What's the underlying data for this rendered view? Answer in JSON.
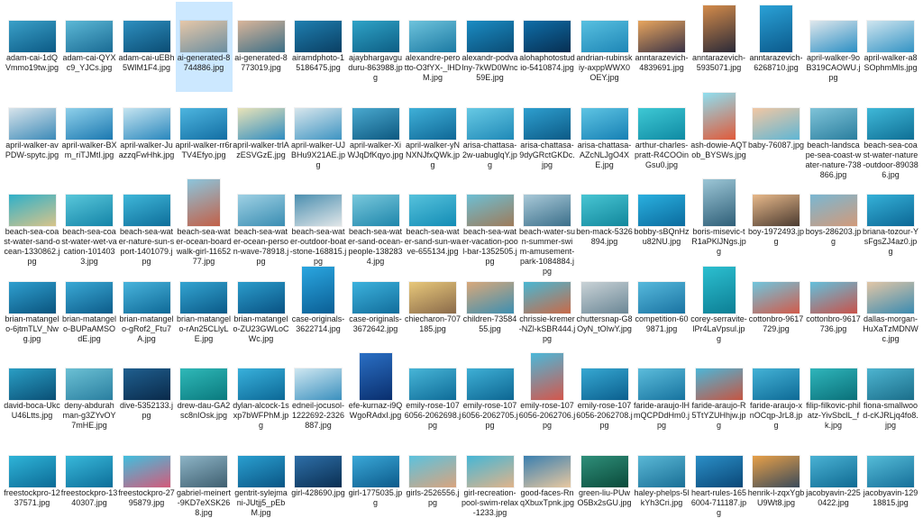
{
  "file_view": {
    "selected_index": 3,
    "files": [
      {
        "name": "adam-cai-1dQVmmo19tw.jpg",
        "orientation": "landscape",
        "colors": [
          "#3aa0c8",
          "#0c5a85"
        ]
      },
      {
        "name": "adam-cai-QYXc9_YJCs.jpg",
        "orientation": "landscape",
        "colors": [
          "#5cb8d6",
          "#1a6b94"
        ]
      },
      {
        "name": "adam-cai-uEBh5WlM1F4.jpg",
        "orientation": "landscape",
        "colors": [
          "#2e8fbf",
          "#0b4d74"
        ]
      },
      {
        "name": "ai-generated-8744886.jpg",
        "orientation": "landscape",
        "colors": [
          "#e6c7a8",
          "#6b8ea0"
        ]
      },
      {
        "name": "ai-generated-8773019.jpg",
        "orientation": "landscape",
        "colors": [
          "#d9b59a",
          "#3b6e86"
        ]
      },
      {
        "name": "airamdphoto-15186475.jpg",
        "orientation": "landscape",
        "colors": [
          "#1f7fb0",
          "#0a3f63"
        ]
      },
      {
        "name": "ajaybhargavguduru-863988.jpg",
        "orientation": "landscape",
        "colors": [
          "#2fa3c7",
          "#0d5e84"
        ]
      },
      {
        "name": "alexandre-perotto-O3fYX-_lHDM.jpg",
        "orientation": "landscape",
        "colors": [
          "#6ec3dc",
          "#1c7aa3"
        ]
      },
      {
        "name": "alexandr-podvalny-7kWD0Wnc59E.jpg",
        "orientation": "landscape",
        "colors": [
          "#1b8cc3",
          "#0a4c75"
        ]
      },
      {
        "name": "alohaphotostudio-5410874.jpg",
        "orientation": "landscape",
        "colors": [
          "#0f6ea8",
          "#072f52"
        ]
      },
      {
        "name": "andrian-rubinskiy-axppWWX0OEY.jpg",
        "orientation": "landscape",
        "colors": [
          "#58c0e0",
          "#1e86b6"
        ]
      },
      {
        "name": "anntarazevich-4839691.jpg",
        "orientation": "landscape",
        "colors": [
          "#e8a55e",
          "#3a3346"
        ]
      },
      {
        "name": "anntarazevich-5935071.jpg",
        "orientation": "portrait",
        "colors": [
          "#d48b4a",
          "#2b2a38"
        ]
      },
      {
        "name": "anntarazevich-6268710.jpg",
        "orientation": "portrait",
        "colors": [
          "#2aa1d6",
          "#0b5a8c"
        ]
      },
      {
        "name": "april-walker-9oB319CAOWU.jpg",
        "orientation": "landscape",
        "colors": [
          "#dfe7ec",
          "#2c8fc4"
        ]
      },
      {
        "name": "april-walker-a8SOphmMls.jpg",
        "orientation": "landscape",
        "colors": [
          "#cfe5ef",
          "#3393c4"
        ]
      },
      {
        "name": "april-walker-avPDW-spytc.jpg",
        "orientation": "landscape",
        "colors": [
          "#d7e3ea",
          "#3c8ab8"
        ]
      },
      {
        "name": "april-walker-BXm_riTJMtI.jpg",
        "orientation": "landscape",
        "colors": [
          "#8fd0ea",
          "#1b78b0"
        ]
      },
      {
        "name": "april-walker-JuazzqFwHhk.jpg",
        "orientation": "landscape",
        "colors": [
          "#c5e4f0",
          "#2987bd"
        ]
      },
      {
        "name": "april-walker-rr6rTV4Efyo.jpg",
        "orientation": "landscape",
        "colors": [
          "#4db5df",
          "#136ea3"
        ]
      },
      {
        "name": "april-walker-trlAzESVGzE.jpg",
        "orientation": "landscape",
        "colors": [
          "#e9e3b8",
          "#2f8cc0"
        ]
      },
      {
        "name": "april-walker-UJBHu9X21AE.jpg",
        "orientation": "landscape",
        "colors": [
          "#d8e6ec",
          "#3e94c2"
        ]
      },
      {
        "name": "april-walker-XiWJqDfKqyo.jpg",
        "orientation": "landscape",
        "colors": [
          "#4aa9cf",
          "#0d5880"
        ]
      },
      {
        "name": "april-walker-yNNXNJfxQWk.jpg",
        "orientation": "landscape",
        "colors": [
          "#3fb0d8",
          "#0f6796"
        ]
      },
      {
        "name": "arisa-chattasa-2w-uabuglqY.jpg",
        "orientation": "landscape",
        "colors": [
          "#67c9e4",
          "#1f89b7"
        ]
      },
      {
        "name": "arisa-chattasa-9dyGRctGKDc.jpg",
        "orientation": "landscape",
        "colors": [
          "#2e9fcf",
          "#0c5a86"
        ]
      },
      {
        "name": "arisa-chattasa-AZcNLJgO4XE.jpg",
        "orientation": "landscape",
        "colors": [
          "#5ec4e3",
          "#1680b4"
        ]
      },
      {
        "name": "arthur-charles-pratt-R4COOinGsu0.jpg",
        "orientation": "landscape",
        "colors": [
          "#3ec8d4",
          "#0f8aa3"
        ]
      },
      {
        "name": "ash-dowie-AQTob_BYSWs.jpg",
        "orientation": "portrait",
        "colors": [
          "#8fdff0",
          "#e05a3a"
        ]
      },
      {
        "name": "baby-76087.jpg",
        "orientation": "landscape",
        "colors": [
          "#f2c7a3",
          "#5fb6d4"
        ]
      },
      {
        "name": "beach-landscape-sea-coast-water-nature-738866.jpg",
        "orientation": "landscape",
        "colors": [
          "#7fc3d8",
          "#2a7e9e"
        ]
      },
      {
        "name": "beach-sea-coast-water-nature-outdoor-890386.jpg",
        "orientation": "landscape",
        "colors": [
          "#3fb8d8",
          "#0f6f95"
        ]
      },
      {
        "name": "beach-sea-coast-water-sand-ocean-1330862.jpg",
        "orientation": "landscape",
        "colors": [
          "#2fb0c9",
          "#d8c48a"
        ]
      },
      {
        "name": "beach-sea-coast-water-wet-vacation-1014033.jpg",
        "orientation": "landscape",
        "colors": [
          "#59c7da",
          "#1484a8"
        ]
      },
      {
        "name": "beach-sea-water-nature-sun-sport-1401079.jpg",
        "orientation": "landscape",
        "colors": [
          "#3fb7d9",
          "#0e6e9a"
        ]
      },
      {
        "name": "beach-sea-water-ocean-boardwalk-girl-1165277.jpg",
        "orientation": "portrait",
        "colors": [
          "#8cc5dc",
          "#c26048"
        ]
      },
      {
        "name": "beach-sea-water-ocean-person-wave-78918.jpg",
        "orientation": "landscape",
        "colors": [
          "#9fd1e4",
          "#3a8db2"
        ]
      },
      {
        "name": "beach-sea-water-outdoor-boat-stone-168815.jpg",
        "orientation": "landscape",
        "colors": [
          "#4b8fb0",
          "#e1e6e8"
        ]
      },
      {
        "name": "beach-sea-water-sand-ocean-people-1382834.jpg",
        "orientation": "landscape",
        "colors": [
          "#79c8dc",
          "#1e86ab"
        ]
      },
      {
        "name": "beach-sea-water-sand-sun-wave-655134.jpg",
        "orientation": "landscape",
        "colors": [
          "#56c2dc",
          "#138cb5"
        ]
      },
      {
        "name": "beach-sea-water-vacation-pool-bar-1352505.jpg",
        "orientation": "landscape",
        "colors": [
          "#6dbfd4",
          "#9e7b5a"
        ]
      },
      {
        "name": "beach-water-sun-summer-swim-amusement-park-1084884.jpg",
        "orientation": "landscape",
        "colors": [
          "#a9c9d8",
          "#3b6f8a"
        ]
      },
      {
        "name": "ben-mack-5326894.jpg",
        "orientation": "landscape",
        "colors": [
          "#48c5d3",
          "#12879c"
        ]
      },
      {
        "name": "bobby-sBQnHzu82NU.jpg",
        "orientation": "landscape",
        "colors": [
          "#2ab0df",
          "#0b6b9e"
        ]
      },
      {
        "name": "boris-misevic-tR1aPKlJNgs.jpg",
        "orientation": "portrait",
        "colors": [
          "#9cc6d6",
          "#2f5f78"
        ]
      },
      {
        "name": "boy-1972493.jpg",
        "orientation": "landscape",
        "colors": [
          "#e8b98a",
          "#4a3a30"
        ]
      },
      {
        "name": "boys-286203.jpg",
        "orientation": "landscape",
        "colors": [
          "#7ab7d2",
          "#d29a7a"
        ]
      },
      {
        "name": "briana-tozour-YsFgsZJ4az0.jpg",
        "orientation": "landscape",
        "colors": [
          "#35b1d8",
          "#0c6795"
        ]
      },
      {
        "name": "brian-matangelo-6jtmTLV_Nwg.jpg",
        "orientation": "landscape",
        "colors": [
          "#2f9fcf",
          "#0a547e"
        ]
      },
      {
        "name": "brian-matangelo-BUPaAMSOdE.jpg",
        "orientation": "landscape",
        "colors": [
          "#3aa9d5",
          "#0d5c8a"
        ]
      },
      {
        "name": "brian-matangelo-gRof2_Ftu7A.jpg",
        "orientation": "landscape",
        "colors": [
          "#48b4dc",
          "#0f6997"
        ]
      },
      {
        "name": "brian-matangelo-rAn25CLlyLE.jpg",
        "orientation": "landscape",
        "colors": [
          "#33a4d1",
          "#0b5a88"
        ]
      },
      {
        "name": "brian-matangelo-ZU23GWLoCWc.jpg",
        "orientation": "landscape",
        "colors": [
          "#2b9ccb",
          "#095283"
        ]
      },
      {
        "name": "case-originals-3622714.jpg",
        "orientation": "portrait",
        "colors": [
          "#2aa6e0",
          "#0b5f95"
        ]
      },
      {
        "name": "case-originals-3672642.jpg",
        "orientation": "landscape",
        "colors": [
          "#3cb2dd",
          "#126d9b"
        ]
      },
      {
        "name": "chiecharon-707185.jpg",
        "orientation": "landscape",
        "colors": [
          "#e8c87a",
          "#8a6a4a"
        ]
      },
      {
        "name": "children-7358455.jpg",
        "orientation": "landscape",
        "colors": [
          "#d9a87a",
          "#3c8fb1"
        ]
      },
      {
        "name": "chrissie-kremer-NZl-kSBR444.jpg",
        "orientation": "landscape",
        "colors": [
          "#49b7d3",
          "#c96a48"
        ]
      },
      {
        "name": "chuttersnap-G8OyN_tOIwY.jpg",
        "orientation": "landscape",
        "colors": [
          "#c9d2d6",
          "#6b8796"
        ]
      },
      {
        "name": "competition-609871.jpg",
        "orientation": "landscape",
        "colors": [
          "#56b9dc",
          "#1a73a2"
        ]
      },
      {
        "name": "corey-serravite-lPr4LaVpsul.jpg",
        "orientation": "portrait",
        "colors": [
          "#2cbfd0",
          "#0d7f95"
        ]
      },
      {
        "name": "cottonbro-9617729.jpg",
        "orientation": "landscape",
        "colors": [
          "#6fc6de",
          "#d25a4a"
        ]
      },
      {
        "name": "cottonbro-9617736.jpg",
        "orientation": "landscape",
        "colors": [
          "#63c0dc",
          "#c9524a"
        ]
      },
      {
        "name": "dallas-morgan-HuXaTzMDNWc.jpg",
        "orientation": "landscape",
        "colors": [
          "#e2c6a6",
          "#3a8bb1"
        ]
      },
      {
        "name": "david-boca-UkcU46Ltts.jpg",
        "orientation": "landscape",
        "colors": [
          "#2a9ec4",
          "#0a4f75"
        ]
      },
      {
        "name": "deny-abdurahman-g3ZYvOY7mHE.jpg",
        "orientation": "landscape",
        "colors": [
          "#6bc0d4",
          "#2a7fa0"
        ]
      },
      {
        "name": "dive-5352133.jpg",
        "orientation": "landscape",
        "colors": [
          "#1f5f8f",
          "#0a2a4a"
        ]
      },
      {
        "name": "drew-dau-GA2sc8nIOsk.jpg",
        "orientation": "landscape",
        "colors": [
          "#2fb8b8",
          "#0a7a7e"
        ]
      },
      {
        "name": "dylan-alcock-1sxp7bWFPhM.jpg",
        "orientation": "landscape",
        "colors": [
          "#38b0db",
          "#0c6896"
        ]
      },
      {
        "name": "edneil-jocusol-1222692-2326887.jpg",
        "orientation": "landscape",
        "colors": [
          "#cfe7f1",
          "#3b90be"
        ]
      },
      {
        "name": "efe-kurnaz-i9QWgoRAdxI.jpg",
        "orientation": "portrait",
        "colors": [
          "#2a6fc4",
          "#0a2f6e"
        ]
      },
      {
        "name": "emily-rose-1076056-2062698.jpg",
        "orientation": "landscape",
        "colors": [
          "#47b5d7",
          "#0f6c98"
        ]
      },
      {
        "name": "emily-rose-1076056-2062705.jpg",
        "orientation": "landscape",
        "colors": [
          "#3eafd5",
          "#0d6692"
        ]
      },
      {
        "name": "emily-rose-1076056-2062706.jpg",
        "orientation": "portrait",
        "colors": [
          "#4bb8d9",
          "#d4574c"
        ]
      },
      {
        "name": "emily-rose-1076056-2062708.jpg",
        "orientation": "landscape",
        "colors": [
          "#36a8d2",
          "#0b5f8e"
        ]
      },
      {
        "name": "faride-araujo-lHmQCPDdHm0.jpg",
        "orientation": "landscape",
        "colors": [
          "#5bbcdb",
          "#17739f"
        ]
      },
      {
        "name": "faride-araujo-R5TtYZUHhjw.jpg",
        "orientation": "landscape",
        "colors": [
          "#4cb6d8",
          "#c65542"
        ]
      },
      {
        "name": "faride-araujo-xnOCqp-JrL8.jpg",
        "orientation": "landscape",
        "colors": [
          "#43b2d6",
          "#0e6a96"
        ]
      },
      {
        "name": "filip-filkovic-philatz-YivSbclL_fk.jpg",
        "orientation": "landscape",
        "colors": [
          "#2fb5bb",
          "#0a7079"
        ]
      },
      {
        "name": "fiona-smallwood-cKJRLjq4fo8.jpg",
        "orientation": "landscape",
        "colors": [
          "#4db4d0",
          "#1b6e8a"
        ]
      },
      {
        "name": "freestockpro-1237571.jpg",
        "orientation": "landscape",
        "colors": [
          "#2fb4d8",
          "#0c6b96"
        ]
      },
      {
        "name": "freestockpro-1340307.jpg",
        "orientation": "landscape",
        "colors": [
          "#38b8da",
          "#0d6e99"
        ]
      },
      {
        "name": "freestockpro-2795879.jpg",
        "orientation": "landscape",
        "colors": [
          "#41bfde",
          "#d45a7a"
        ]
      },
      {
        "name": "gabriel-meinert-9KD7eXSK268.jpg",
        "orientation": "landscape",
        "colors": [
          "#8db4c6",
          "#3f5f70"
        ]
      },
      {
        "name": "gentrit-sylejmani-JUtjj5_pEbM.jpg",
        "orientation": "landscape",
        "colors": [
          "#2a9fd0",
          "#0a5584"
        ]
      },
      {
        "name": "girl-428690.jpg",
        "orientation": "landscape",
        "colors": [
          "#2e6fa8",
          "#0a2f52"
        ]
      },
      {
        "name": "girl-1775035.jpg",
        "orientation": "landscape",
        "colors": [
          "#3aa8d8",
          "#0c5a8a"
        ]
      },
      {
        "name": "girls-2526556.jpg",
        "orientation": "landscape",
        "colors": [
          "#5cc2de",
          "#d9a47e"
        ]
      },
      {
        "name": "girl-recreation-pool-swim-relax-1233.jpg",
        "orientation": "landscape",
        "colors": [
          "#46b6d6",
          "#e0b48a"
        ]
      },
      {
        "name": "good-faces-RnqXbuxTpnk.jpg",
        "orientation": "landscape",
        "colors": [
          "#3a7fb0",
          "#e8c8a0"
        ]
      },
      {
        "name": "green-liu-PUwO5Bx2sGU.jpg",
        "orientation": "landscape",
        "colors": [
          "#2f8f7a",
          "#0a4a3a"
        ]
      },
      {
        "name": "haley-phelps-5lkYh3Cri.jpg",
        "orientation": "landscape",
        "colors": [
          "#5ab8d6",
          "#1a6f96"
        ]
      },
      {
        "name": "heart-rules-1656004-711187.jpg",
        "orientation": "landscape",
        "colors": [
          "#2b8fc7",
          "#0a4777"
        ]
      },
      {
        "name": "henrik-l-zqxYgbU9Wt8.jpg",
        "orientation": "landscape",
        "colors": [
          "#e8a048",
          "#3a4a5a"
        ]
      },
      {
        "name": "jacobyavin-2250422.jpg",
        "orientation": "landscape",
        "colors": [
          "#4ab2d4",
          "#0f6a92"
        ]
      },
      {
        "name": "jacobyavin-12918815.jpg",
        "orientation": "landscape",
        "colors": [
          "#55bcd8",
          "#166f99"
        ]
      }
    ]
  }
}
